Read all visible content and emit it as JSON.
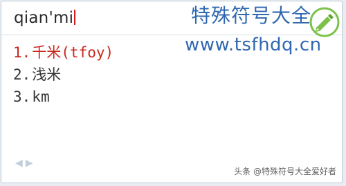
{
  "input": {
    "pinyin": "qian'mi"
  },
  "watermark": {
    "title": "特殊符号大全",
    "url": "www.tsfhdq.cn"
  },
  "candidates": [
    {
      "number": "1.",
      "text": "千米(tfoy)",
      "selected": true
    },
    {
      "number": "2.",
      "text": "浅米",
      "selected": false
    },
    {
      "number": "3.",
      "text": "km",
      "selected": false
    }
  ],
  "nav": {
    "prev": "◀",
    "next": "▶"
  },
  "footer": {
    "text": "头条 @特殊符号大全爱好者"
  },
  "colors": {
    "selected_candidate": "#c8281e",
    "caret": "#d21d1d",
    "watermark": "#2f67b0",
    "icon_green": "#7cc24a"
  },
  "icons": [
    "pencil-logo-icon",
    "prev-page-icon",
    "next-page-icon"
  ]
}
